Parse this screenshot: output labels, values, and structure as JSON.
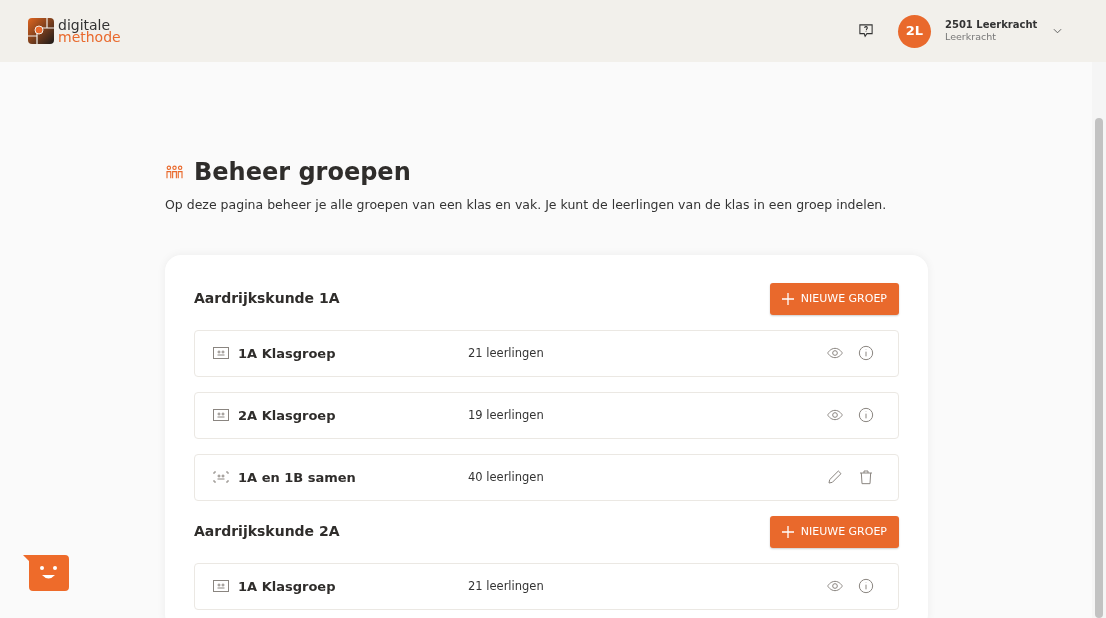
{
  "header": {
    "logo": {
      "line1": "digitale",
      "line2": "methode"
    },
    "user": {
      "initials": "2L",
      "name": "2501 Leerkracht",
      "role": "Leerkracht"
    }
  },
  "page": {
    "title": "Beheer groepen",
    "description": "Op deze pagina beheer je alle groepen van een klas en vak. Je kunt de leerlingen van de klas in een groep indelen."
  },
  "sections": [
    {
      "title": "Aardrijkskunde 1A",
      "button": "NIEUWE GROEP",
      "groups": [
        {
          "kind": "class",
          "name": "1A Klasgroep",
          "count": "21 leerlingen"
        },
        {
          "kind": "class",
          "name": "2A Klasgroep",
          "count": "19 leerlingen"
        },
        {
          "kind": "combined",
          "name": "1A en 1B samen",
          "count": "40 leerlingen"
        }
      ]
    },
    {
      "title": "Aardrijkskunde 2A",
      "button": "NIEUWE GROEP",
      "groups": [
        {
          "kind": "class",
          "name": "1A Klasgroep",
          "count": "21 leerlingen"
        }
      ]
    }
  ]
}
